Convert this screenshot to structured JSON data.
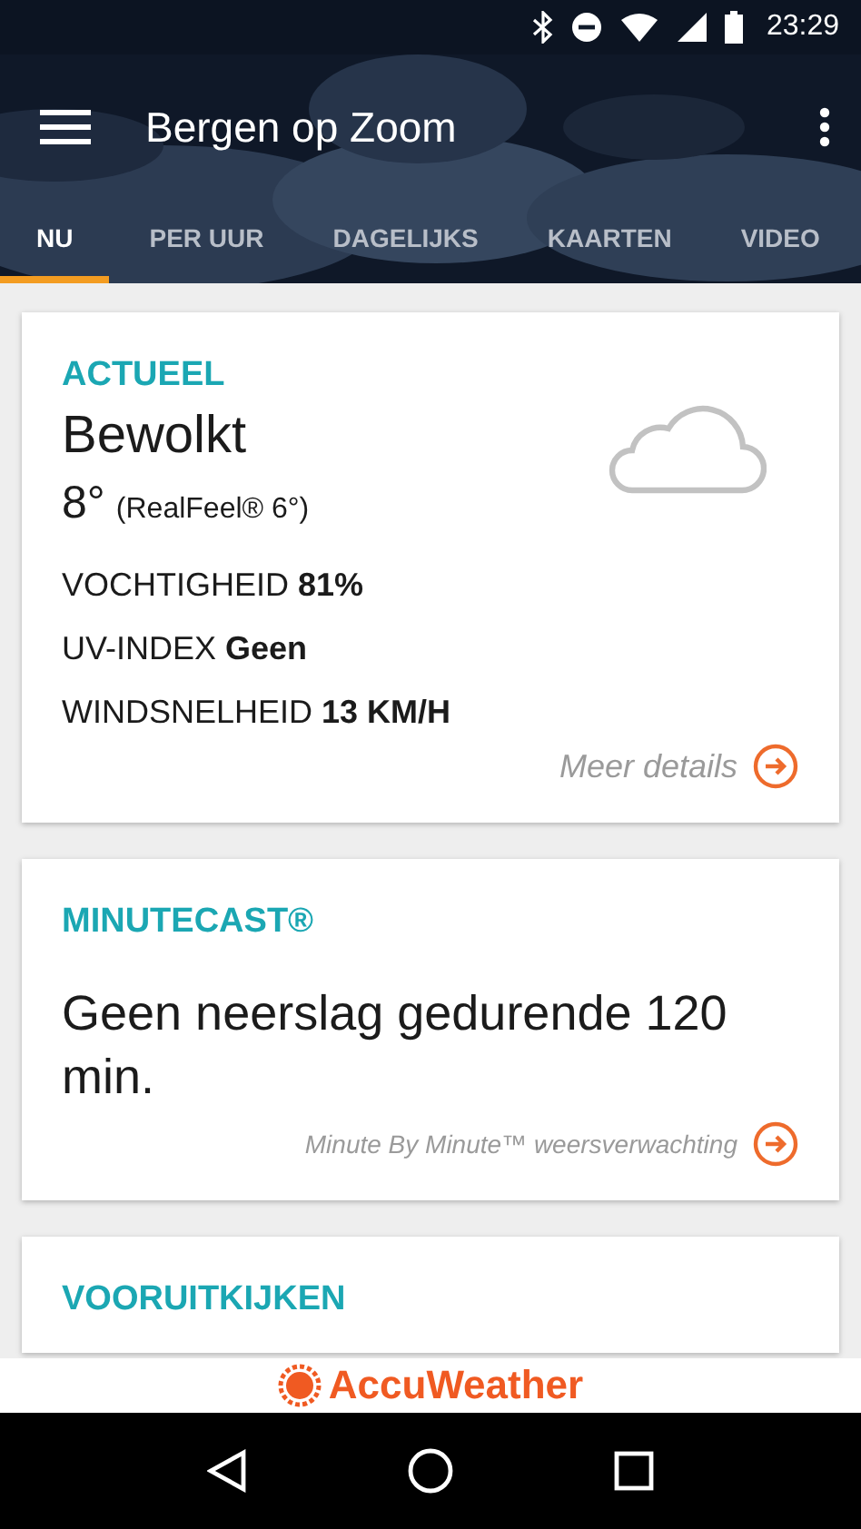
{
  "status_bar": {
    "time": "23:29"
  },
  "toolbar": {
    "title": "Bergen op Zoom"
  },
  "tabs": [
    {
      "label": "NU",
      "selected": true
    },
    {
      "label": "PER UUR",
      "selected": false
    },
    {
      "label": "DAGELIJKS",
      "selected": false
    },
    {
      "label": "KAARTEN",
      "selected": false
    },
    {
      "label": "VIDEO",
      "selected": false
    }
  ],
  "current": {
    "heading": "ACTUEEL",
    "condition": "Bewolkt",
    "temperature": "8°",
    "realfeel": "(RealFeel® 6°)",
    "details": [
      "VOCHTIGHEID **81%**",
      "UV-INDEX **Geen**",
      "WINDSNELHEID **13 KM/H**"
    ],
    "link": "Meer details"
  },
  "minutecast": {
    "heading": "MINUTECAST®",
    "summary": "Geen neerslag gedurende 120 min.",
    "link": "Minute By Minute™ weersverwachting"
  },
  "outlook": {
    "heading": "VOORUITKIJKEN"
  },
  "footer": {
    "brand": "AccuWeather"
  }
}
